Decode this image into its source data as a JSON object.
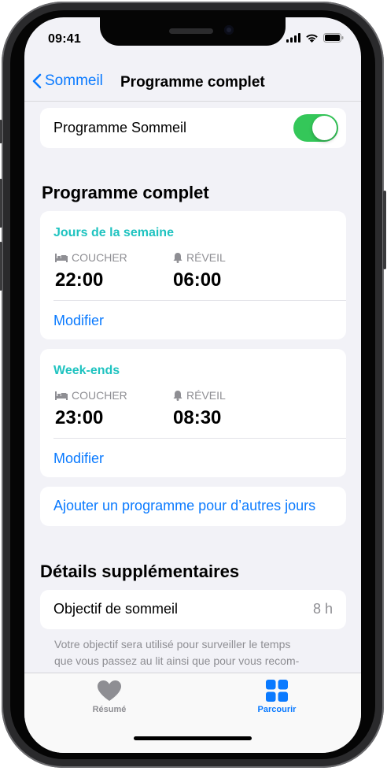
{
  "status_bar": {
    "time": "09:41"
  },
  "nav": {
    "back_label": "Sommeil",
    "title": "Programme complet"
  },
  "sleep_schedule": {
    "label": "Programme Sommeil",
    "enabled": true
  },
  "full_schedule": {
    "heading": "Programme complet",
    "schedules": [
      {
        "title": "Jours de la semaine",
        "bed_label": "COUCHER",
        "bed_time": "22:00",
        "wake_label": "RÉVEIL",
        "wake_time": "06:00",
        "edit_label": "Modifier"
      },
      {
        "title": "Week-ends",
        "bed_label": "COUCHER",
        "bed_time": "23:00",
        "wake_label": "RÉVEIL",
        "wake_time": "08:30",
        "edit_label": "Modifier"
      }
    ],
    "add_label": "Ajouter un programme pour d’autres jours"
  },
  "additional": {
    "heading": "Détails supplémentaires",
    "goal_label": "Objectif de sommeil",
    "goal_value": "8 h",
    "footer_line1": "Votre objectif sera utilisé pour surveiller le temps",
    "footer_line2": "que vous passez au lit ainsi que pour vous recom-"
  },
  "tabbar": {
    "tabs": [
      {
        "label": "Résumé",
        "icon": "heart-icon",
        "active": false
      },
      {
        "label": "Parcourir",
        "icon": "grid-icon",
        "active": true
      }
    ]
  },
  "colors": {
    "accent": "#0a7aff",
    "toggle_on": "#34c759",
    "schedule_title": "#1fc3c0"
  }
}
